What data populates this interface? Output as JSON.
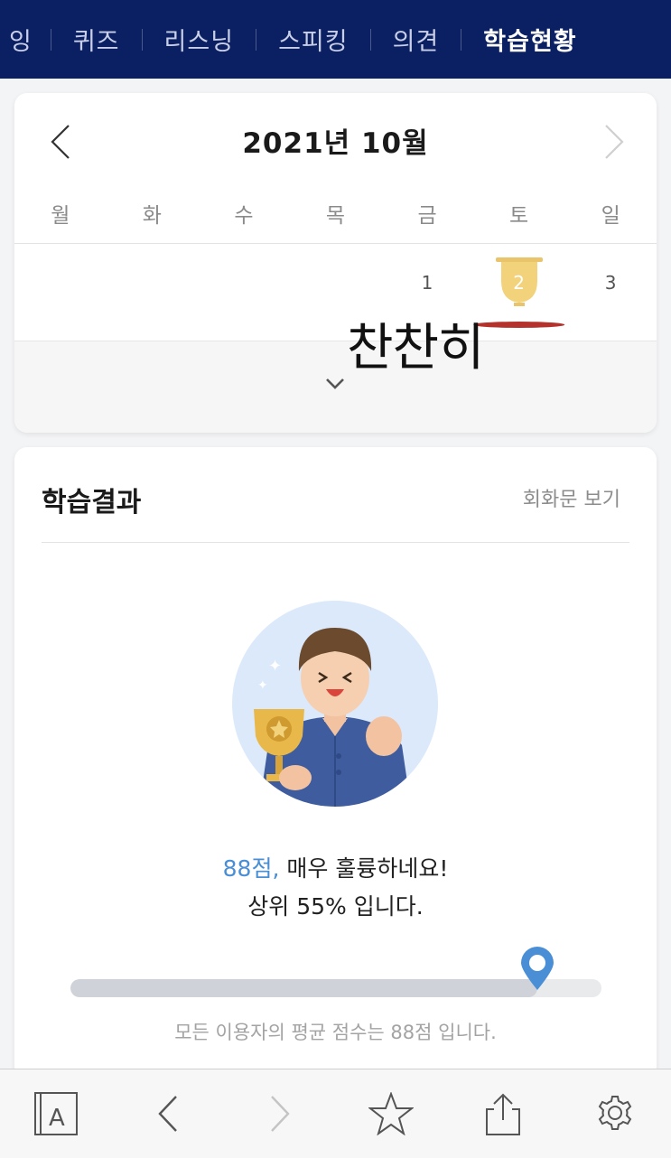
{
  "nav": {
    "tabs": [
      {
        "label": "잉",
        "active": false
      },
      {
        "label": "퀴즈",
        "active": false
      },
      {
        "label": "리스닝",
        "active": false
      },
      {
        "label": "스피킹",
        "active": false
      },
      {
        "label": "의견",
        "active": false
      },
      {
        "label": "학습현황",
        "active": true
      }
    ]
  },
  "calendar": {
    "title": "2021년  10월",
    "weekdays": [
      "월",
      "화",
      "수",
      "목",
      "금",
      "토",
      "일"
    ],
    "days": [
      "",
      "",
      "",
      "",
      "1",
      "2",
      "3"
    ],
    "trophy_day": "2",
    "overlay_text": "찬찬히"
  },
  "result": {
    "title": "학습결과",
    "link": "회화문 보기",
    "score": "88점,",
    "praise": " 매우 훌륭하네요!",
    "rank": "상위 55% 입니다.",
    "progress_fraction": 0.88,
    "average": "모든 이용자의 평균 점수는 88점 입니다."
  },
  "toolbar": {
    "icons": [
      "reader-mode-icon",
      "back-icon",
      "forward-icon",
      "bookmark-star-icon",
      "share-icon",
      "settings-gear-icon"
    ]
  },
  "colors": {
    "nav_bg": "#0b1f63",
    "accent_blue": "#4a8fd6",
    "trophy_gold": "#f2d27a",
    "dot_red": "#b5312b"
  }
}
